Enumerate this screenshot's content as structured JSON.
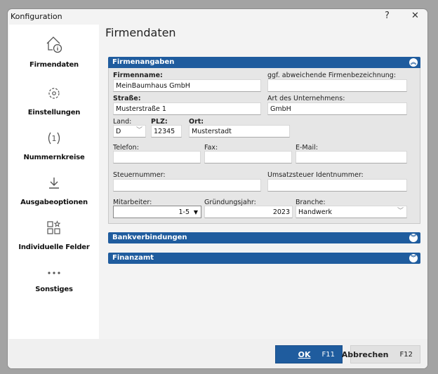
{
  "window": {
    "title": "Konfiguration",
    "help": "?",
    "close": "✕"
  },
  "sidebar": {
    "items": [
      {
        "label": "Firmendaten",
        "icon": "house-info-icon"
      },
      {
        "label": "Einstellungen",
        "icon": "gear-icon"
      },
      {
        "label": "Nummernkreise",
        "icon": "number-cycle-icon"
      },
      {
        "label": "Ausgabeoptionen",
        "icon": "download-icon"
      },
      {
        "label": "Individuelle Felder",
        "icon": "custom-fields-icon"
      },
      {
        "label": "Sonstiges",
        "icon": "more-icon"
      }
    ]
  },
  "page": {
    "title": "Firmendaten"
  },
  "sections": {
    "firmenangaben": "Firmenangaben",
    "bank": "Bankverbindungen",
    "finanzamt": "Finanzamt"
  },
  "form": {
    "firmenname": {
      "label": "Firmenname:",
      "value": "MeinBaumhaus GmbH"
    },
    "abweichend": {
      "label": "ggf. abweichende Firmenbezeichnung:",
      "value": ""
    },
    "strasse": {
      "label": "Straße:",
      "value": "Musterstraße 1"
    },
    "art": {
      "label": "Art des Unternehmens:",
      "value": "GmbH"
    },
    "land": {
      "label": "Land:",
      "value": "D"
    },
    "plz": {
      "label": "PLZ:",
      "value": "12345"
    },
    "ort": {
      "label": "Ort:",
      "value": "Musterstadt"
    },
    "telefon": {
      "label": "Telefon:",
      "value": ""
    },
    "fax": {
      "label": "Fax:",
      "value": ""
    },
    "email": {
      "label": "E-Mail:",
      "value": ""
    },
    "steuernummer": {
      "label": "Steuernummer:",
      "value": ""
    },
    "ustid": {
      "label": "Umsatzsteuer Identnummer:",
      "value": ""
    },
    "mitarbeiter": {
      "label": "Mitarbeiter:",
      "value": "1-5"
    },
    "gruendungsjahr": {
      "label": "Gründungsjahr:",
      "value": "2023"
    },
    "branche": {
      "label": "Branche:",
      "value": "Handwerk"
    }
  },
  "footer": {
    "ok_label": "OK",
    "ok_key": "F11",
    "cancel_label": "Abbrechen",
    "cancel_key": "F12"
  }
}
